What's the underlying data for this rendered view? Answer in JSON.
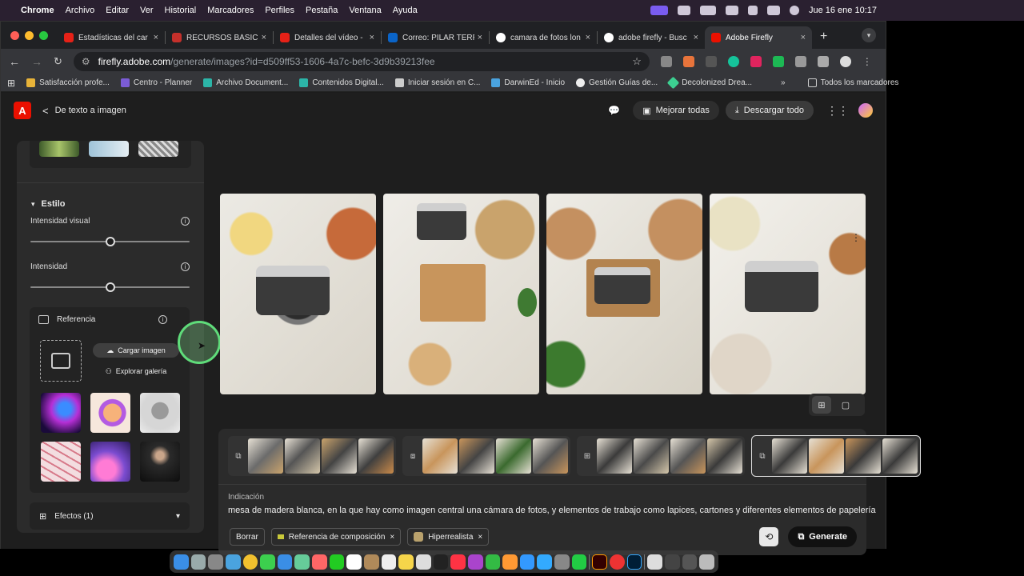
{
  "menubar": {
    "apple": "",
    "app": "Chrome",
    "items": [
      "Archivo",
      "Editar",
      "Ver",
      "Historial",
      "Marcadores",
      "Perfiles",
      "Pestaña",
      "Ventana",
      "Ayuda"
    ],
    "clock": "Jue 16 ene 10:17"
  },
  "tabs": [
    {
      "label": "Estadísticas del car",
      "favcolor": "#e62117"
    },
    {
      "label": "RECURSOS BÁSICO",
      "favcolor": "#c4302b"
    },
    {
      "label": "Detalles del vídeo -",
      "favcolor": "#e62117"
    },
    {
      "label": "Correo: PILAR TERR",
      "favcolor": "#0a64c8"
    },
    {
      "label": "camara de fotos lon",
      "favcolor": "#ffffff"
    },
    {
      "label": "adobe firefly - Busc",
      "favcolor": "#ffffff"
    },
    {
      "label": "Adobe Firefly",
      "favcolor": "#eb1000"
    }
  ],
  "tab_close": "×",
  "new_tab": "+",
  "omnibox": {
    "domain": "firefly.adobe.com",
    "path": "/generate/images?id=d509ff53-1606-4a7c-befc-3d9b39213fee"
  },
  "bookmarks": [
    "Satisfacción profe...",
    "Centro - Planner",
    "Archivo Document...",
    "Contenidos Digital...",
    "Iniciar sesión en C...",
    "DarwinEd - Inicio",
    "Gestión Guías de...",
    "Decolonized Drea..."
  ],
  "bookmarks_more": "»",
  "bookmarks_all": "Todos los marcadores",
  "app": {
    "logo": "A",
    "back": "<",
    "breadcrumb": "De texto a imagen",
    "improve_all": "Mejorar todas",
    "download_all": "Descargar todo"
  },
  "sidebar": {
    "style_header": "Estilo",
    "visual_intensity": "Intensidad visual",
    "visual_intensity_value": 0.5,
    "intensity": "Intensidad",
    "intensity_value": 0.5,
    "info": "i",
    "reference": "Referencia",
    "upload_image": "Cargar imagen",
    "explore_gallery": "Explorar galería",
    "effects": "Efectos (1)"
  },
  "prompt": {
    "label": "Indicación",
    "text": "mesa de madera blanca, en la que hay como imagen central una cámara de fotos, y elementos de trabajo como lapices, cartones y diferentes elementos de papelería"
  },
  "chips": {
    "clear": "Borrar",
    "composition_ref": "Referencia de composición",
    "photoreal": "Hiperrealista",
    "remove": "×"
  },
  "generate": "Generate",
  "colors": {
    "accent": "#eb1000",
    "active_ring": "#5fdc7a"
  }
}
